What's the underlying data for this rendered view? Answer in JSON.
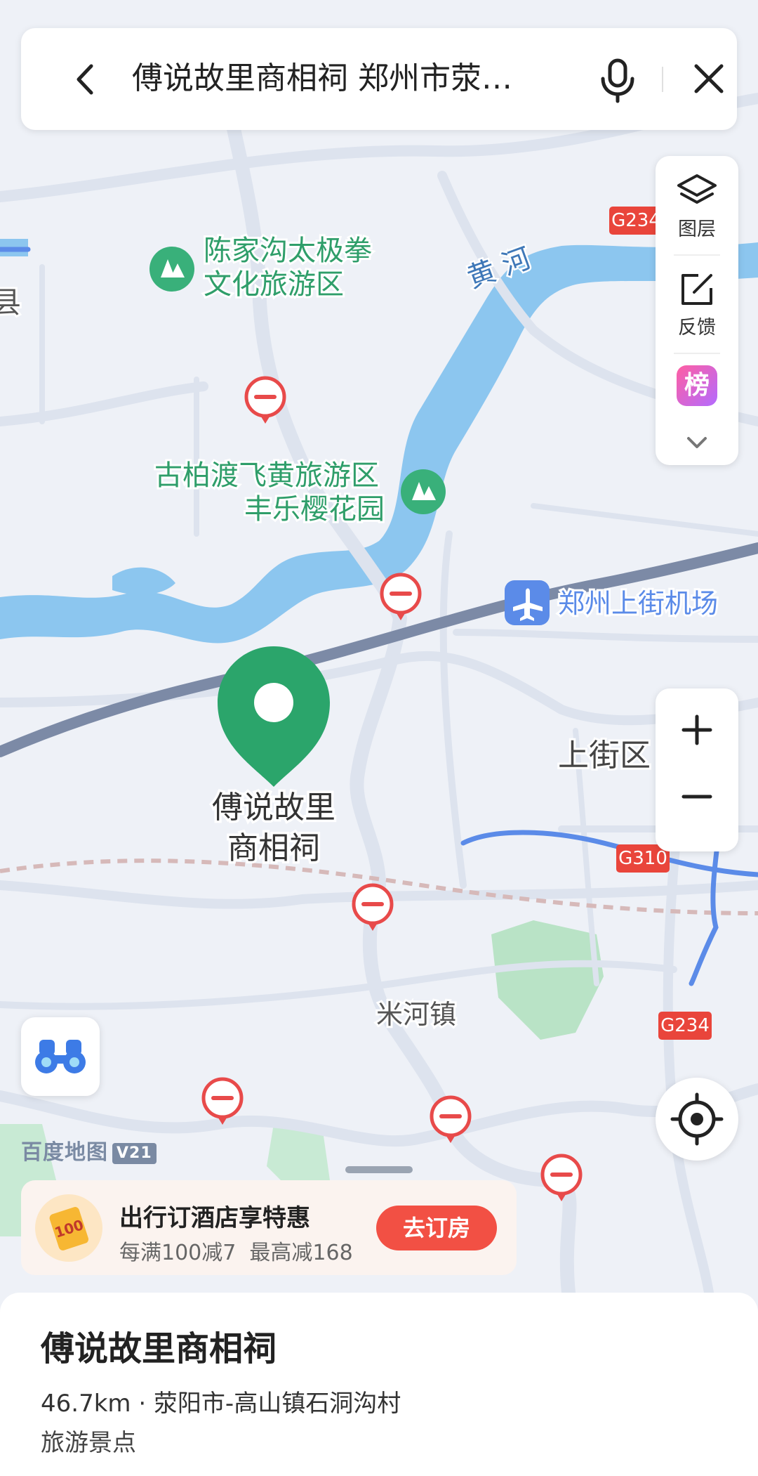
{
  "search": {
    "query": "傅说故里商相祠 郑州市荥…"
  },
  "side_panel": {
    "layers_label": "图层",
    "feedback_label": "反馈",
    "rank_icon_text": "榜"
  },
  "map": {
    "labels": {
      "chenjiagou_1": "陈家沟太极拳",
      "chenjiagou_2": "文化旅游区",
      "county_fragment": "县",
      "yellow_river": "黄 河",
      "gubaidu_1": "古柏渡飞黄旅游区",
      "gubaidu_2": "丰乐樱花园",
      "airport": "郑州上街机场",
      "shangjie": "上街区",
      "pin_1": "傅说故里",
      "pin_2": "商相祠",
      "mihe": "米河镇"
    },
    "road_shields": [
      "G234",
      "G310",
      "G234"
    ],
    "logo": "百度地图",
    "logo_version": "V21"
  },
  "promo": {
    "title": "出行订酒店享特惠",
    "subtitle": "每满100减7  最高减168",
    "button": "去订房",
    "badge_text": "100"
  },
  "place": {
    "name": "傅说故里商相祠",
    "detail": "46.7km · 荥阳市-高山镇石洞沟村",
    "category": "旅游景点"
  },
  "colors": {
    "accent_green": "#2ba56b",
    "water": "#8cc6ef",
    "road": "#dde3ee",
    "highway": "#7c8aa6",
    "promo_button": "#f25044"
  }
}
